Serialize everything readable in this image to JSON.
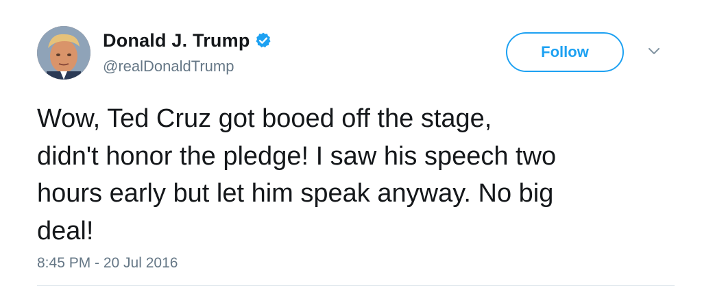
{
  "user": {
    "display_name": "Donald J. Trump",
    "handle": "@realDonaldTrump",
    "verified": true,
    "avatar_icon": "user-avatar-photo"
  },
  "actions": {
    "follow_label": "Follow",
    "more_icon": "chevron-down-icon"
  },
  "tweet": {
    "text": "Wow, Ted Cruz got booed off the stage,\ndidn't honor the pledge! I saw his speech two\nhours early but let him speak anyway. No big\ndeal!",
    "timestamp": "8:45 PM - 20 Jul 2016"
  },
  "colors": {
    "accent": "#1da1f2",
    "text": "#14171a",
    "secondary_text": "#657786"
  }
}
